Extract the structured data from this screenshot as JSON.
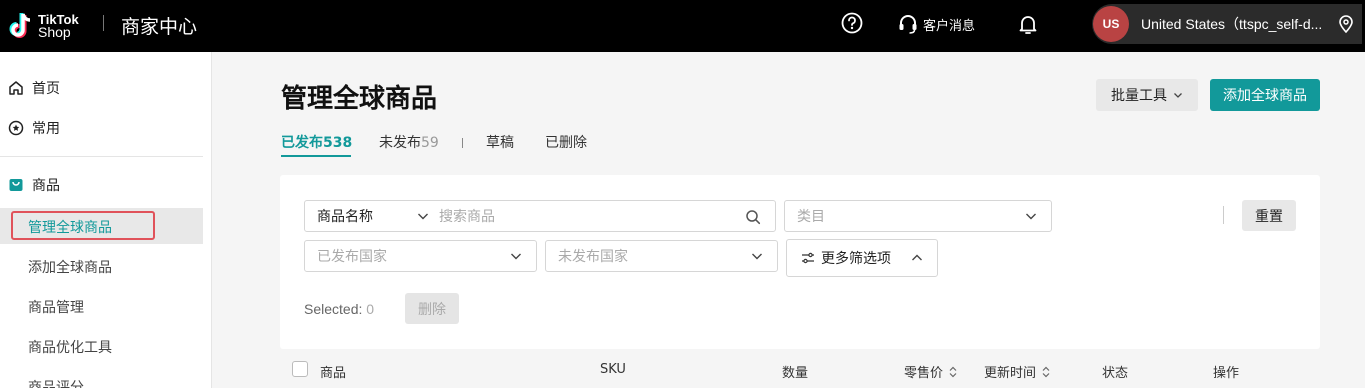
{
  "topbar": {
    "logo_line1": "TikTok",
    "logo_line2": "Shop",
    "app_title": "商家中心",
    "help_icon": "help-circle-icon",
    "customer_service_label": "客户消息",
    "bell_icon": "bell-icon",
    "avatar_initials": "US",
    "account_name": "United States（ttspc_self-d..."
  },
  "sidebar": {
    "home": "首页",
    "favorites": "常用",
    "products": "商品",
    "sub_items": [
      "管理全球商品",
      "添加全球商品",
      "商品管理",
      "商品优化工具",
      "商品评分"
    ]
  },
  "main": {
    "title": "管理全球商品",
    "batch_tools": "批量工具",
    "add_button": "添加全球商品",
    "tabs": [
      {
        "label": "已发布",
        "count": "538"
      },
      {
        "label": "未发布",
        "count": "59"
      },
      {
        "label": "草稿",
        "count": ""
      },
      {
        "label": "已删除",
        "count": ""
      }
    ]
  },
  "filters": {
    "field_select": "商品名称",
    "search_placeholder": "搜索商品",
    "category_placeholder": "类目",
    "published_country_placeholder": "已发布国家",
    "unpublished_country_placeholder": "未发布国家",
    "more_filters": "更多筛选项",
    "reset": "重置",
    "selected_label": "Selected:",
    "selected_count": "0",
    "delete": "删除"
  },
  "table": {
    "headers": [
      "商品",
      "SKU",
      "数量",
      "零售价",
      "更新时间",
      "状态",
      "操作"
    ]
  },
  "colors": {
    "accent": "#12999a",
    "highlight_outline": "#e0525a",
    "avatar": "#b94343"
  }
}
